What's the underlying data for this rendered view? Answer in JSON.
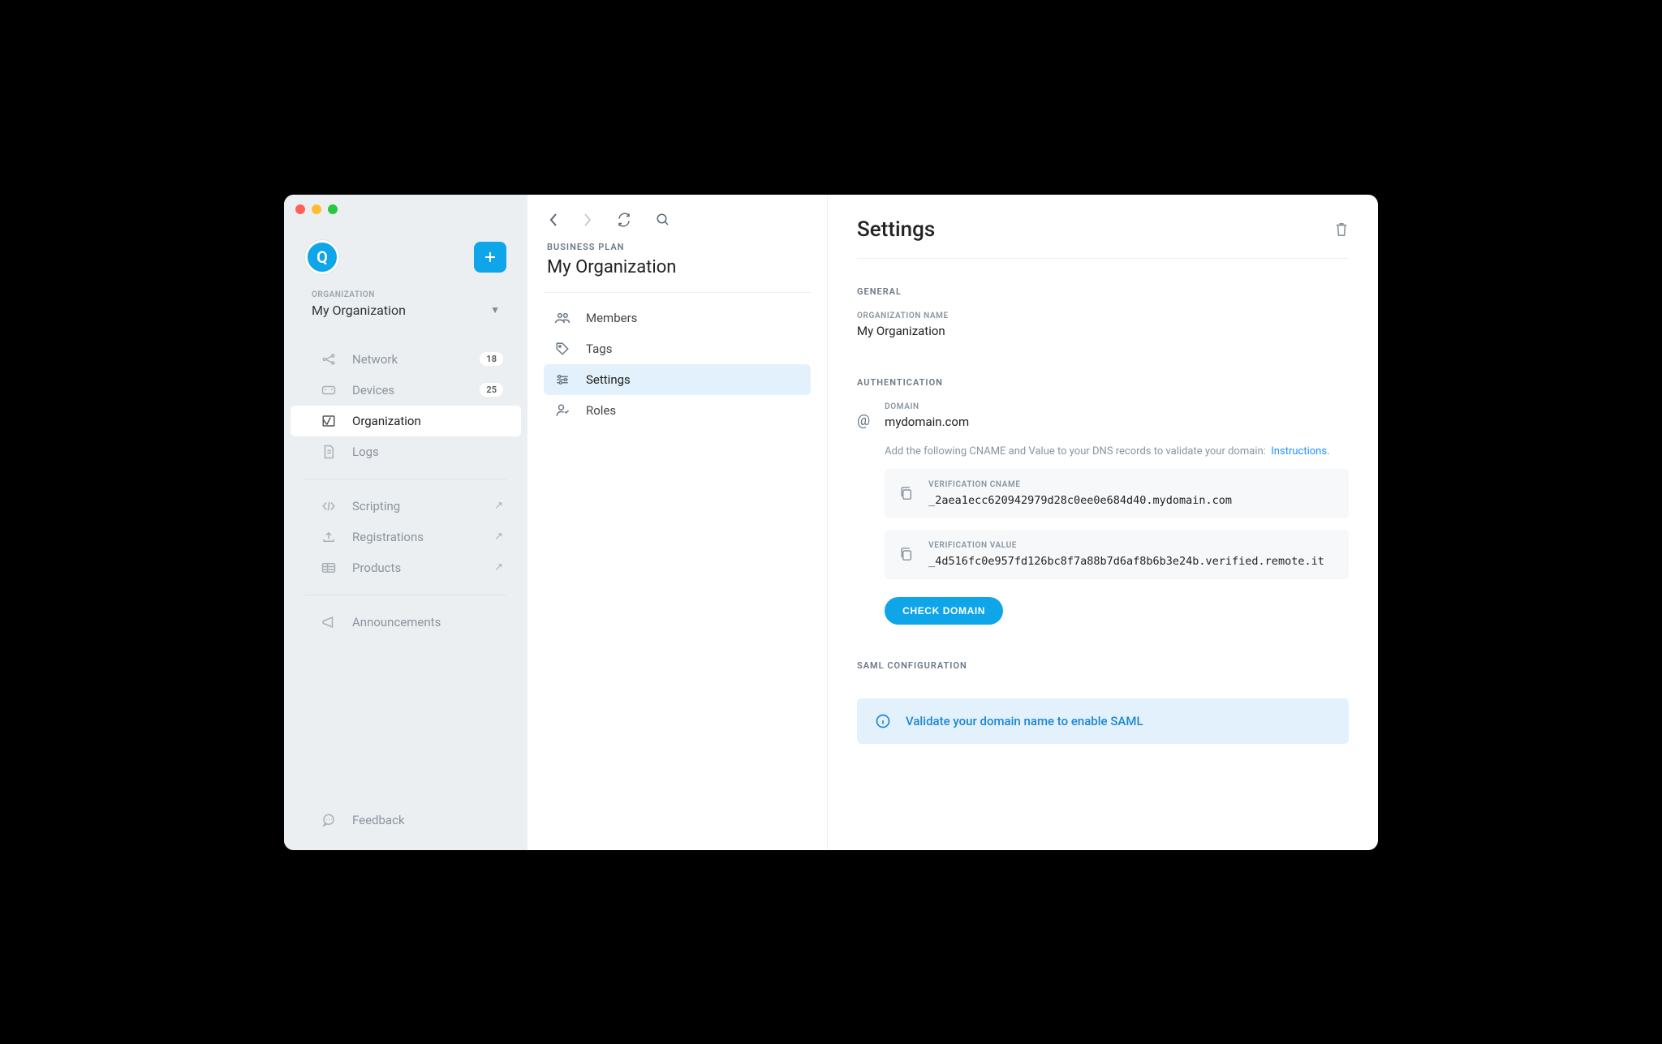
{
  "traffic": [
    "red",
    "yellow",
    "green"
  ],
  "avatar_letter": "Q",
  "sidebar": {
    "org_label": "ORGANIZATION",
    "org_name": "My Organization",
    "items": [
      {
        "label": "Network",
        "badge": "18"
      },
      {
        "label": "Devices",
        "badge": "25"
      },
      {
        "label": "Organization"
      },
      {
        "label": "Logs"
      }
    ],
    "ext": [
      {
        "label": "Scripting"
      },
      {
        "label": "Registrations"
      },
      {
        "label": "Products"
      }
    ],
    "announcements": "Announcements",
    "feedback": "Feedback"
  },
  "midcol": {
    "plan": "BUSINESS PLAN",
    "title": "My Organization",
    "items": [
      {
        "label": "Members"
      },
      {
        "label": "Tags"
      },
      {
        "label": "Settings"
      },
      {
        "label": "Roles"
      }
    ]
  },
  "content": {
    "title": "Settings",
    "general_label": "GENERAL",
    "org_name_label": "ORGANIZATION NAME",
    "org_name_value": "My Organization",
    "auth_label": "AUTHENTICATION",
    "domain_label": "DOMAIN",
    "domain_value": "mydomain.com",
    "help_text": "Add the following CNAME and Value to your DNS records to validate your domain:",
    "instructions_link": "Instructions.",
    "cname_label": "VERIFICATION CNAME",
    "cname_value": "_2aea1ecc620942979d28c0ee0e684d40.mydomain.com",
    "vvalue_label": "VERIFICATION VALUE",
    "vvalue_value": "_4d516fc0e957fd126bc8f7a88b7d6af8b6b3e24b.verified.remote.it",
    "check_btn": "CHECK DOMAIN",
    "saml_label": "SAML CONFIGURATION",
    "info_text": "Validate your domain name to enable SAML"
  }
}
